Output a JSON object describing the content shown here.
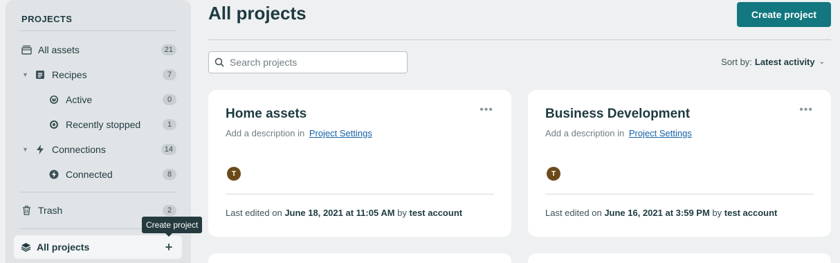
{
  "sidebar": {
    "heading": "PROJECTS",
    "items": [
      {
        "label": "All assets",
        "count": "21",
        "icon": "archive-box-icon"
      },
      {
        "label": "Recipes",
        "count": "7",
        "icon": "recipe-icon"
      },
      {
        "label": "Active",
        "count": "0",
        "icon": "active-status-icon"
      },
      {
        "label": "Recently stopped",
        "count": "1",
        "icon": "stopped-status-icon"
      },
      {
        "label": "Connections",
        "count": "14",
        "icon": "lightning-icon"
      },
      {
        "label": "Connected",
        "count": "8",
        "icon": "connected-icon"
      },
      {
        "label": "Trash",
        "count": "2",
        "icon": "trash-icon"
      }
    ],
    "all_projects": {
      "label": "All projects",
      "add_symbol": "+"
    },
    "tooltip": "Create project"
  },
  "header": {
    "title": "All projects",
    "create_button": "Create project"
  },
  "toolbar": {
    "search_placeholder": "Search projects",
    "sort_prefix": "Sort by:",
    "sort_value": "Latest activity"
  },
  "projects": [
    {
      "title": "Home assets",
      "desc_prefix": "Add a description in",
      "desc_link": "Project Settings",
      "avatar": "T",
      "edited_prefix": "Last edited on",
      "edited_date": "June 18, 2021 at 11:05 AM",
      "edited_by_prefix": "by",
      "edited_by": "test account"
    },
    {
      "title": "Business Development",
      "desc_prefix": "Add a description in",
      "desc_link": "Project Settings",
      "avatar": "T",
      "edited_prefix": "Last edited on",
      "edited_date": "June 16, 2021 at 3:59 PM",
      "edited_by_prefix": "by",
      "edited_by": "test account"
    }
  ],
  "colors": {
    "accent": "#12777f",
    "avatar": "#6b4a1a",
    "link": "#1463a8"
  }
}
